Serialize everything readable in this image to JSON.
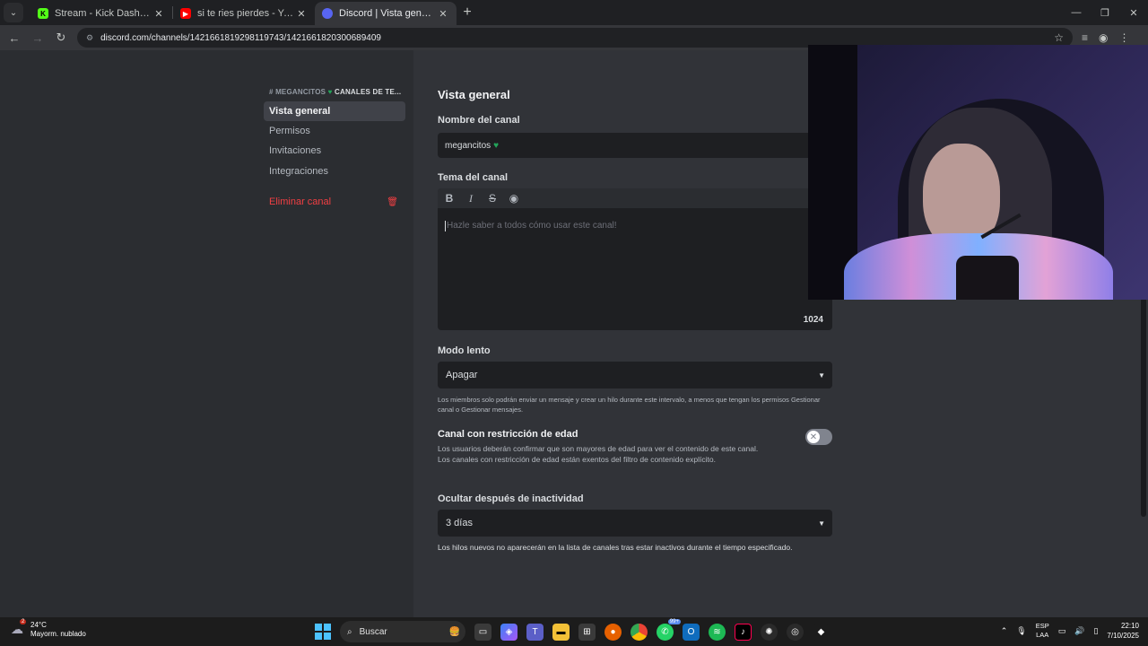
{
  "browser": {
    "tabs": [
      {
        "title": "Stream - Kick Dashboard",
        "active": false,
        "favicon": "kick-icon"
      },
      {
        "title": "si te ries pierdes - YouTube",
        "active": false,
        "favicon": "youtube-icon"
      },
      {
        "title": "Discord | Vista general | Megan",
        "active": true,
        "favicon": "discord-icon"
      }
    ],
    "url": "discord.com/channels/1421661819298119743/1421661820300689409"
  },
  "sidebar": {
    "header_prefix": "# MEGANCITOS",
    "header_suffix": "CANALES DE TE...",
    "items": [
      {
        "label": "Vista general",
        "selected": true
      },
      {
        "label": "Permisos"
      },
      {
        "label": "Invitaciones"
      },
      {
        "label": "Integraciones"
      }
    ],
    "delete_label": "Eliminar canal"
  },
  "overview": {
    "title": "Vista general",
    "name_label": "Nombre del canal",
    "name_value": "megancitos",
    "topic_label": "Tema del canal",
    "topic_placeholder": "Hazle saber a todos cómo usar este canal!",
    "topic_counter": "1024",
    "slowmode_label": "Modo lento",
    "slowmode_value": "Apagar",
    "slowmode_help": "Los miembros solo podrán enviar un mensaje y crear un hilo durante este intervalo, a menos que tengan los permisos Gestionar canal o Gestionar mensajes.",
    "nsfw_title": "Canal con restricción de edad",
    "nsfw_desc_1": "Los usuarios deberán confirmar que son mayores de edad para ver el contenido de este canal.",
    "nsfw_desc_2": "Los canales con restricción de edad están exentos del filtro de contenido explícito.",
    "nsfw_enabled": false,
    "hide_label": "Ocultar después de inactividad",
    "hide_value": "3 días",
    "hide_help": "Los hilos nuevos no aparecerán en la lista de canales tras estar inactivos durante el tiempo especificado."
  },
  "taskbar": {
    "weather_temp": "24°C",
    "weather_desc": "Mayorm. nublado",
    "weather_badge": "2",
    "search_placeholder": "Buscar",
    "whatsapp_badge": "99+",
    "lang_1": "ESP",
    "lang_2": "LAA",
    "time": "22:10",
    "date": "7/10/2025"
  },
  "colors": {
    "discord_bg": "#313338",
    "sidebar_bg": "#2b2d31",
    "danger": "#f23f43",
    "heart": "#23a55a"
  }
}
